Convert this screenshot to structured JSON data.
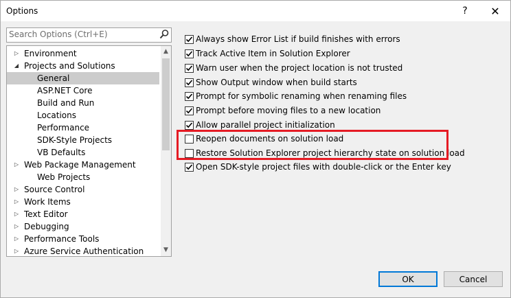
{
  "window": {
    "title": "Options",
    "help_glyph": "?",
    "close_glyph": "✕"
  },
  "search": {
    "placeholder": "Search Options (Ctrl+E)"
  },
  "tree": {
    "items": [
      {
        "label": "Environment",
        "arrow": "▷",
        "level": 0
      },
      {
        "label": "Projects and Solutions",
        "arrow": "◢",
        "level": 0
      },
      {
        "label": "General",
        "arrow": "",
        "level": 2,
        "selected": true
      },
      {
        "label": "ASP.NET Core",
        "arrow": "",
        "level": 2
      },
      {
        "label": "Build and Run",
        "arrow": "",
        "level": 2
      },
      {
        "label": "Locations",
        "arrow": "",
        "level": 2
      },
      {
        "label": "Performance",
        "arrow": "",
        "level": 2
      },
      {
        "label": "SDK-Style Projects",
        "arrow": "",
        "level": 2
      },
      {
        "label": "VB Defaults",
        "arrow": "",
        "level": 2
      },
      {
        "label": "Web Package Management",
        "arrow": "▷",
        "level": 1
      },
      {
        "label": "Web Projects",
        "arrow": "",
        "level": 2
      },
      {
        "label": "Source Control",
        "arrow": "▷",
        "level": 0
      },
      {
        "label": "Work Items",
        "arrow": "▷",
        "level": 0
      },
      {
        "label": "Text Editor",
        "arrow": "▷",
        "level": 0
      },
      {
        "label": "Debugging",
        "arrow": "▷",
        "level": 0
      },
      {
        "label": "Performance Tools",
        "arrow": "▷",
        "level": 0
      },
      {
        "label": "Azure Service Authentication",
        "arrow": "▷",
        "level": 0
      }
    ]
  },
  "options": [
    {
      "label": "Always show Error List if build finishes with errors",
      "checked": true
    },
    {
      "label": "Track Active Item in Solution Explorer",
      "checked": true
    },
    {
      "label": "Warn user when the project location is not trusted",
      "checked": true
    },
    {
      "label": "Show Output window when build starts",
      "checked": true
    },
    {
      "label": "Prompt for symbolic renaming when renaming files",
      "checked": true
    },
    {
      "label": "Prompt before moving files to a new location",
      "checked": true
    },
    {
      "label": "Allow parallel project initialization",
      "checked": true
    },
    {
      "label": "Reopen documents on solution load",
      "checked": false
    },
    {
      "label": "Restore Solution Explorer project hierarchy state on solution load",
      "checked": false
    },
    {
      "label": "Open SDK-style project files with double-click or the Enter key",
      "checked": true
    }
  ],
  "buttons": {
    "ok": "OK",
    "cancel": "Cancel"
  },
  "colors": {
    "highlight": "#e51b24",
    "selected_bg": "#cccccc",
    "accent": "#0078d7"
  }
}
